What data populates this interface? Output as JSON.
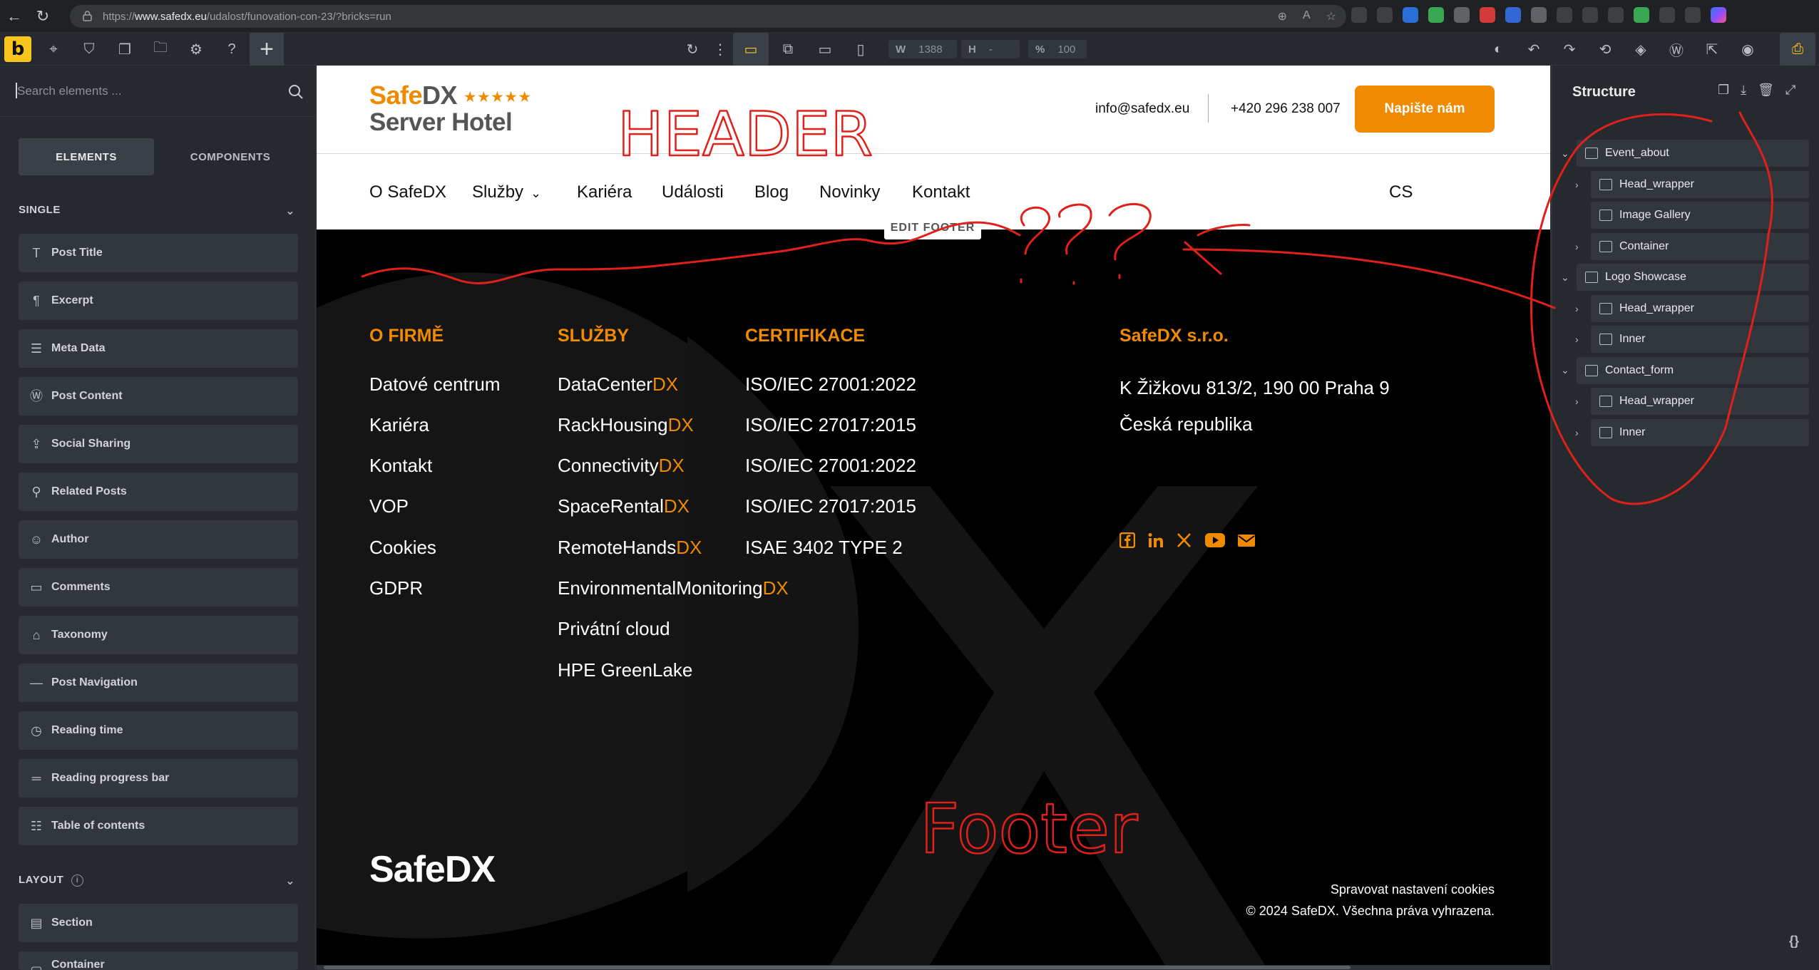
{
  "browser": {
    "url_prefix": "https://",
    "url_host": "www.safedx.eu",
    "url_path": "/udalost/funovation-con-23/?bricks=run"
  },
  "toolbar": {
    "logo": "b",
    "width_label": "W",
    "width_value": "1388",
    "height_label": "H",
    "height_value": "-",
    "zoom_label": "%",
    "zoom_value": "100"
  },
  "left_panel": {
    "search_placeholder": "Search elements ...",
    "tabs": [
      "ELEMENTS",
      "COMPONENTS"
    ],
    "section_single": "SINGLE",
    "section_layout": "LAYOUT",
    "items": [
      {
        "label": "Post Title",
        "icon": "text-t-icon"
      },
      {
        "label": "Excerpt",
        "icon": "paragraph-icon"
      },
      {
        "label": "Meta Data",
        "icon": "list-icon"
      },
      {
        "label": "Post Content",
        "icon": "wordpress-icon"
      },
      {
        "label": "Social Sharing",
        "icon": "share-icon"
      },
      {
        "label": "Related Posts",
        "icon": "pin-icon"
      },
      {
        "label": "Author",
        "icon": "user-icon"
      },
      {
        "label": "Comments",
        "icon": "comment-icon"
      },
      {
        "label": "Taxonomy",
        "icon": "tag-icon"
      },
      {
        "label": "Post Navigation",
        "icon": "minus-icon"
      },
      {
        "label": "Reading time",
        "icon": "clock-icon"
      },
      {
        "label": "Reading progress bar",
        "icon": "bars-icon"
      },
      {
        "label": "Table of contents",
        "icon": "toc-icon"
      }
    ],
    "layout_items": [
      {
        "label": "Section",
        "icon": "section-icon"
      },
      {
        "label": "Container",
        "icon": "container-icon"
      }
    ]
  },
  "site": {
    "logo_safe": "Safe",
    "logo_dx": "DX",
    "logo_stars": "★★★★★",
    "logo_line2": "Server Hotel",
    "email": "info@safedx.eu",
    "phone": "+420 296 238 007",
    "cta": "Napište nám",
    "nav": [
      "O SafeDX",
      "Služby",
      "Kariéra",
      "Události",
      "Blog",
      "Novinky",
      "Kontakt"
    ],
    "lang": "CS",
    "edit_footer": "EDIT FOOTER",
    "footer": {
      "col1_head": "O FIRMĚ",
      "col1": [
        "Datové centrum",
        "Kariéra",
        "Kontakt",
        "VOP",
        "Cookies",
        "GDPR"
      ],
      "col2_head": "SLUŽBY",
      "col2": [
        {
          "base": "DataCenter",
          "dx": "DX"
        },
        {
          "base": "RackHousing",
          "dx": "DX"
        },
        {
          "base": "Connectivity",
          "dx": "DX"
        },
        {
          "base": "SpaceRental",
          "dx": "DX"
        },
        {
          "base": "RemoteHands",
          "dx": "DX"
        },
        {
          "base": "EnvironmentalMonitoring",
          "dx": "DX"
        },
        {
          "base": "Privátní cloud",
          "dx": ""
        },
        {
          "base": "HPE GreenLake",
          "dx": ""
        }
      ],
      "col3_head": "CERTIFIKACE",
      "col3": [
        "ISO/IEC 27001:2022",
        "ISO/IEC 27017:2015",
        "ISO/IEC 27001:2022",
        "ISO/IEC 27017:2015",
        "ISAE 3402 TYPE 2"
      ],
      "col4_head": "SafeDX s.r.o.",
      "address1": "K Žižkovu 813/2, 190 00 Praha 9",
      "address2": "Česká republika",
      "socials": [
        "facebook-icon",
        "linkedin-icon",
        "x-icon",
        "youtube-icon",
        "mail-icon"
      ],
      "logo": "SafeDX",
      "cookie_link": "Spravovat nastavení cookies",
      "copyright": "© 2024 SafeDX. Všechna práva vyhrazena."
    }
  },
  "right_panel": {
    "title": "Structure",
    "tree": [
      {
        "label": "Event_about",
        "level": 0,
        "expanded": true,
        "icon": "section-icon"
      },
      {
        "label": "Head_wrapper",
        "level": 1,
        "expanded": false,
        "icon": "container-icon"
      },
      {
        "label": "Image Gallery",
        "level": 1,
        "expanded": null,
        "icon": "gallery-icon"
      },
      {
        "label": "Container",
        "level": 1,
        "expanded": false,
        "icon": "container-icon"
      },
      {
        "label": "Logo Showcase",
        "level": 0,
        "expanded": true,
        "icon": "section-icon"
      },
      {
        "label": "Head_wrapper",
        "level": 1,
        "expanded": false,
        "icon": "container-icon"
      },
      {
        "label": "Inner",
        "level": 1,
        "expanded": false,
        "icon": "container-icon"
      },
      {
        "label": "Contact_form",
        "level": 0,
        "expanded": true,
        "icon": "section-icon"
      },
      {
        "label": "Head_wrapper",
        "level": 1,
        "expanded": false,
        "icon": "container-icon"
      },
      {
        "label": "Inner",
        "level": 1,
        "expanded": false,
        "icon": "container-icon"
      }
    ],
    "bottom_icon": "{}"
  },
  "annotations": {
    "header_text": "HEADER",
    "footer_text": "Footer",
    "color": "#e0201b"
  }
}
